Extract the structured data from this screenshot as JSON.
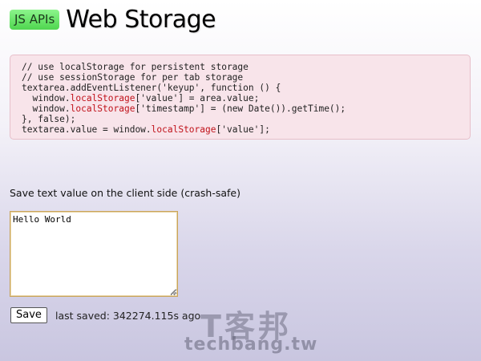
{
  "header": {
    "badge": "JS APIs",
    "title": "Web Storage"
  },
  "code": {
    "lines": [
      [
        {
          "t": "// use localStorage for persistent storage"
        }
      ],
      [
        {
          "t": "// use sessionStorage for per tab storage"
        }
      ],
      [
        {
          "t": "textarea.addEventListener('keyup', function () {"
        }
      ],
      [
        {
          "t": "  window."
        },
        {
          "t": "localStorage",
          "kw": true
        },
        {
          "t": "['value'] = area.value;"
        }
      ],
      [
        {
          "t": "  window."
        },
        {
          "t": "localStorage",
          "kw": true
        },
        {
          "t": "['timestamp'] = (new Date()).getTime();"
        }
      ],
      [
        {
          "t": "}, false);"
        }
      ],
      [
        {
          "t": "textarea.value = window."
        },
        {
          "t": "localStorage",
          "kw": true
        },
        {
          "t": "['value'];"
        }
      ]
    ],
    "keyword_color": "#c0121a"
  },
  "demo": {
    "label": "Save text value on the client side (crash-safe)",
    "textarea_value": "Hello World",
    "save_label": "Save",
    "last_saved": "last saved: 342274.115s ago"
  },
  "watermark": {
    "chinese": "T客邦",
    "english": "techbang.tw"
  }
}
